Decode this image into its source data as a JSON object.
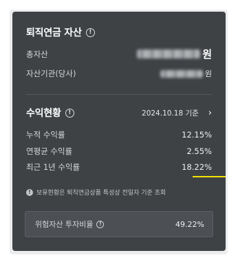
{
  "assets": {
    "title": "퇴직연금 자산",
    "total_label": "총자산",
    "total_unit": "원",
    "institution_label": "자산기관(당사)",
    "institution_unit": "원"
  },
  "returns": {
    "title": "수익현황",
    "date": "2024.10.18 기준",
    "rows": [
      {
        "label": "누적 수익률",
        "value": "12.15%"
      },
      {
        "label": "연평균 수익률",
        "value": "2.55%"
      },
      {
        "label": "최근 1년 수익률",
        "value": "18.22%"
      }
    ]
  },
  "notice": "보유현황은 퇴직연금상품 특성상 전일자 기준 조회",
  "risk": {
    "label": "위험자산 투자비율",
    "value": "49.22%"
  },
  "icons": {
    "info": "info-icon",
    "notice": "exclamation-icon",
    "chevron": "chevron-right-icon"
  },
  "colors": {
    "card_bg": "#3f4245",
    "highlight": "#f5e400"
  }
}
